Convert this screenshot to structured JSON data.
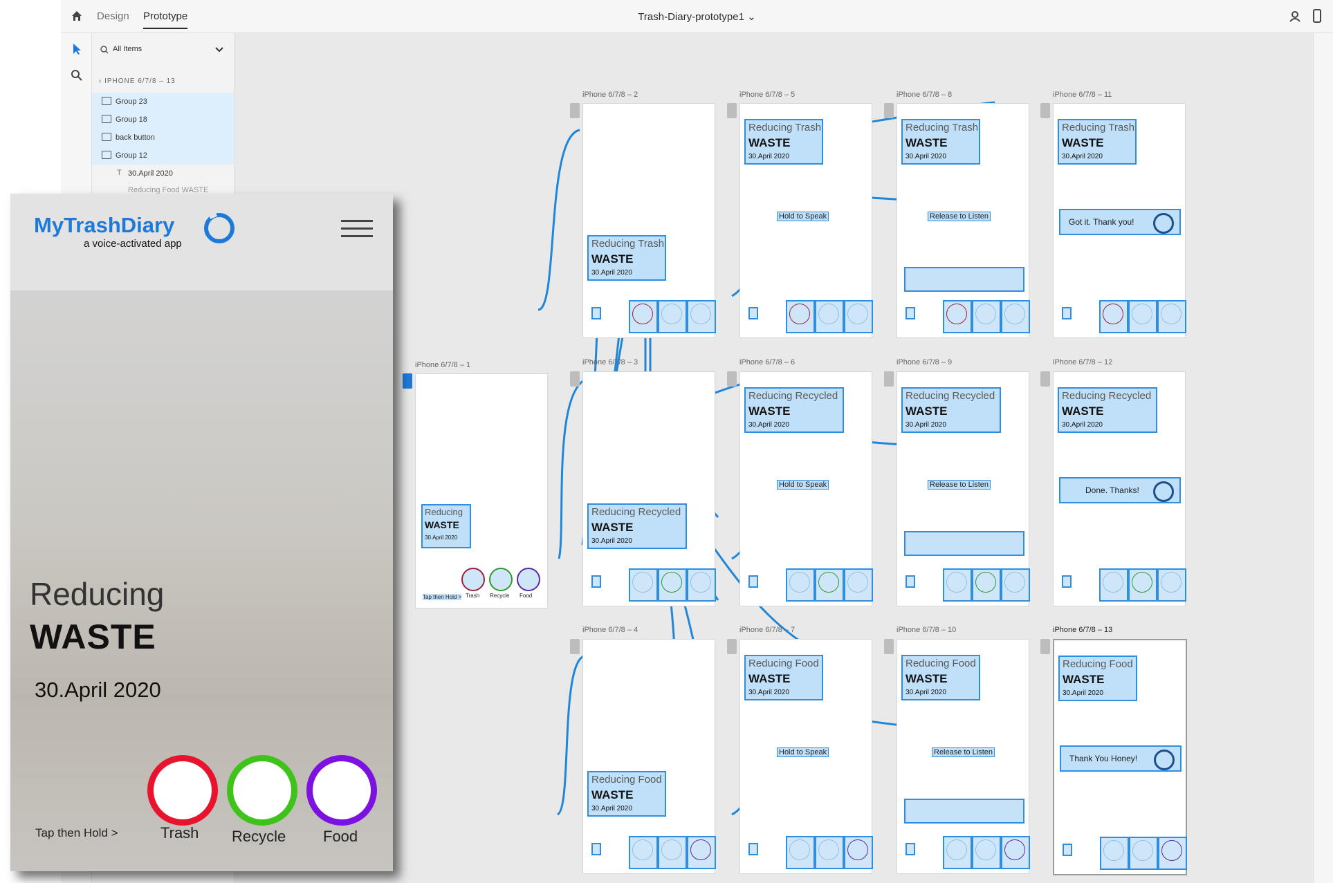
{
  "toolbar": {
    "tab_design": "Design",
    "tab_prototype": "Prototype",
    "doc_title": "Trash-Diary-prototype1 ⌄"
  },
  "layers": {
    "search_placeholder": "All Items",
    "parent": "IPHONE 6/7/8 – 13",
    "items": [
      "Group 23",
      "Group 18",
      "back button",
      "Group 12",
      "30.April 2020",
      "Reducing Food WASTE"
    ]
  },
  "artboards": {
    "a1": "iPhone 6/7/8 – 1",
    "a2": "iPhone 6/7/8 – 2",
    "a3": "iPhone 6/7/8 – 3",
    "a4": "iPhone 6/7/8 – 4",
    "a5": "iPhone 6/7/8 – 5",
    "a6": "iPhone 6/7/8 – 6",
    "a7": "iPhone 6/7/8 – 7",
    "a8": "iPhone 6/7/8 – 8",
    "a9": "iPhone 6/7/8 – 9",
    "a10": "iPhone 6/7/8 – 10",
    "a11": "iPhone 6/7/8 – 11",
    "a12": "iPhone 6/7/8 – 12",
    "a13": "iPhone 6/7/8 – 13"
  },
  "content": {
    "reducing": "Reducing",
    "reducing_trash": "Reducing Trash",
    "reducing_recycled": "Reducing Recycled",
    "reducing_food": "Reducing Food",
    "waste": "WASTE",
    "date": "30.April 2020",
    "hold": "Hold to Speak",
    "release": "Release to Listen",
    "thanks_trash": "Got it.  Thank you!",
    "thanks_recycled": "Done. Thanks!",
    "thanks_food": "Thank You Honey!",
    "mini_trash": "Trash",
    "mini_recycle": "Recycle",
    "mini_food": "Food",
    "tap_hold": "Tap then Hold >"
  },
  "phone": {
    "brand": "MyTrashDiary",
    "tagline": "a voice-activated app",
    "reducing": "Reducing",
    "waste": "WASTE",
    "date": "30.April 2020",
    "tap_hold": "Tap then Hold  >",
    "buttons": [
      {
        "label": "Trash",
        "color": "#e8142e"
      },
      {
        "label": "Recycle",
        "color": "#3fc21a"
      },
      {
        "label": "Food",
        "color": "#7c12e0"
      }
    ]
  },
  "colors": {
    "accent": "#1e7ad8",
    "wire": "#1f86d8"
  }
}
